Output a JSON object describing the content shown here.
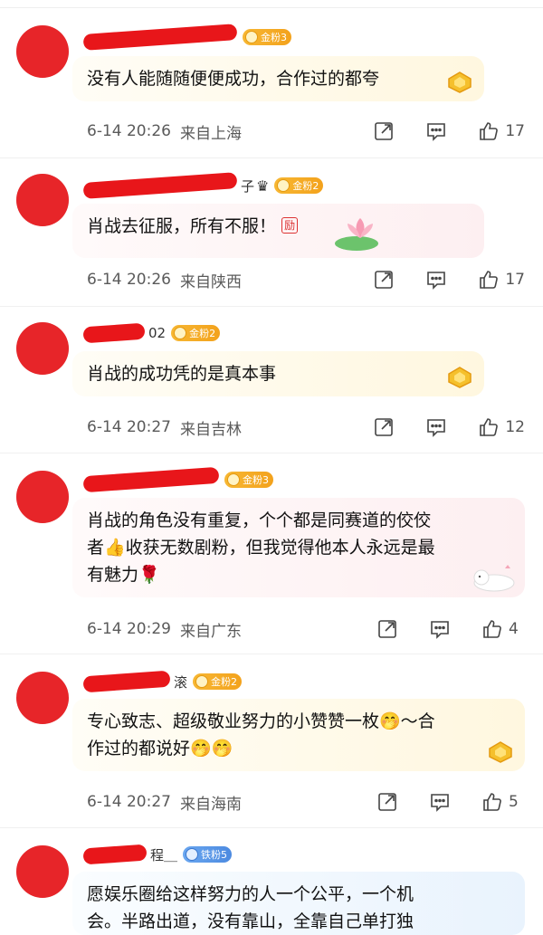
{
  "comments": [
    {
      "name_tail": "",
      "badge": "金粉3",
      "text": "没有人能随随便便成功，合作过的都夸",
      "date": "6-14 20:26",
      "location": "来自上海",
      "likes": "17"
    },
    {
      "name_tail": "子",
      "badge": "金粉2",
      "text": "肖战去征服，所有不服！",
      "date": "6-14 20:26",
      "location": "来自陕西",
      "likes": "17"
    },
    {
      "name_tail": "02",
      "badge": "金粉2",
      "text": "肖战的成功凭的是真本事",
      "date": "6-14 20:27",
      "location": "来自吉林",
      "likes": "12"
    },
    {
      "name_tail": "",
      "badge": "金粉3",
      "text_lines": [
        "肖战的角色没有重复，个个都是同赛道的佼佼",
        "者👍收获无数剧粉，但我觉得他本人永远是最",
        "有魅力🌹"
      ],
      "date": "6-14 20:29",
      "location": "来自广东",
      "likes": "4"
    },
    {
      "name_tail": "滚",
      "badge": "金粉2",
      "text_lines": [
        "专心致志、超级敬业努力的小赞赞一枚🤭～合",
        "作过的都说好🤭🤭"
      ],
      "date": "6-14 20:27",
      "location": "来自海南",
      "likes": "5"
    },
    {
      "name_tail": "程＿",
      "badge": "铁粉5",
      "text_lines": [
        "愿娱乐圈给这样努力的人一个公平，一个机",
        "会。半路出道，没有靠山，全靠自己单打独"
      ]
    }
  ],
  "icons": {
    "share": "share-icon",
    "comment": "comment-icon",
    "like": "thumbs-up-icon"
  },
  "colors": {
    "redaction": "#e8161a",
    "gold_badge": "#f3a21c",
    "iron_badge": "#4c8ae0"
  }
}
